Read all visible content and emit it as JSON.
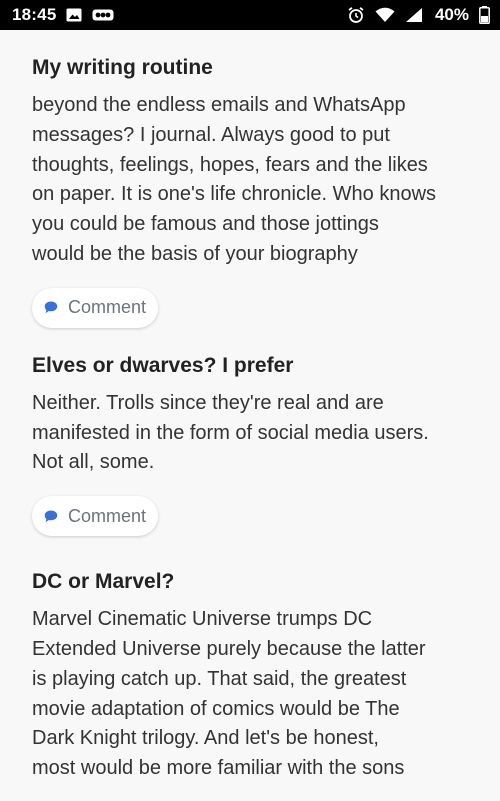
{
  "status_bar": {
    "time": "18:45",
    "battery": "40%",
    "icons": [
      "gallery-icon",
      "carrier-logo-icon",
      "alarm-icon",
      "wifi-icon",
      "signal-icon",
      "battery-icon"
    ]
  },
  "posts": [
    {
      "title": "My writing routine",
      "body_lines": [
        "beyond the endless emails and WhatsApp",
        "messages? I journal. Always good to put",
        "thoughts, feelings, hopes, fears and the likes",
        "on paper. It is one's life chronicle. Who knows",
        "you could be famous and those jottings",
        "would be the basis of your biography"
      ],
      "comment_label": "Comment"
    },
    {
      "title": "Elves or dwarves? I prefer",
      "body_lines": [
        "Neither. Trolls since they're real and are",
        "manifested in the form of social media users.",
        "Not all, some."
      ],
      "comment_label": "Comment"
    },
    {
      "title": "DC or Marvel?",
      "body_lines": [
        "Marvel Cinematic Universe trumps DC",
        "Extended Universe purely because the latter",
        "is playing catch up. That said, the greatest",
        "movie adaptation of comics would be The",
        "Dark Knight trilogy. And let's be honest,",
        "most would be more familiar with the sons"
      ]
    }
  ],
  "colors": {
    "accent": "#3b6fd8",
    "background": "#f8f8f8",
    "status_bar": "#000000"
  }
}
